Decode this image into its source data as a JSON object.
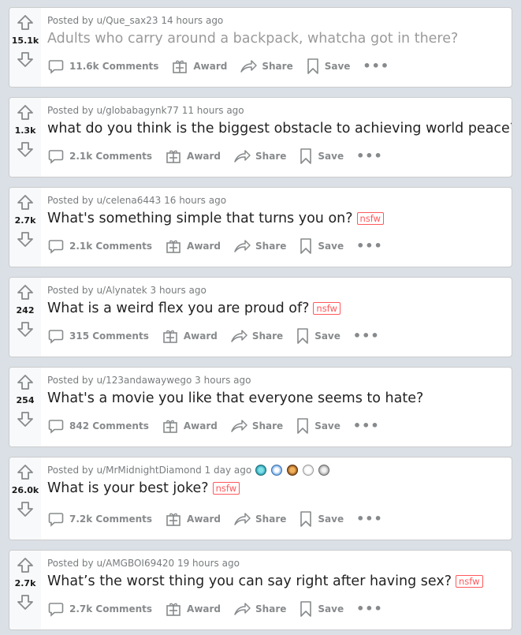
{
  "feed": {
    "posts": [
      {
        "author": "Posted by u/Que_sax23 14 hours ago",
        "score": "15.1k",
        "title": "Adults who carry around a backpack, whatcha got in there?",
        "comments": "11.6k Comments",
        "nsfw": false,
        "visited": true
      },
      {
        "author": "Posted by u/globabagynk77 11 hours ago",
        "score": "1.3k",
        "title": "what do you think is the biggest obstacle to achieving world peace?",
        "comments": "2.1k Comments",
        "nsfw": false,
        "visited": false
      },
      {
        "author": "Posted by u/celena6443 16 hours ago",
        "score": "2.7k",
        "title": "What's something simple that turns you on?",
        "comments": "2.1k Comments",
        "nsfw": true,
        "visited": false
      },
      {
        "author": "Posted by u/Alynatek 3 hours ago",
        "score": "242",
        "title": "What is a weird flex you are proud of?",
        "comments": "315 Comments",
        "nsfw": true,
        "visited": false
      },
      {
        "author": "Posted by u/123andawaywego 3 hours ago",
        "score": "254",
        "title": "What's a movie you like that everyone seems to hate?",
        "comments": "842 Comments",
        "nsfw": false,
        "visited": false
      },
      {
        "author": "Posted by u/MrMidnightDiamond 1 day ago",
        "score": "26.0k",
        "title": "What is your best joke?",
        "comments": "7.2k Comments",
        "nsfw": true,
        "visited": false,
        "awards": [
          "diamond-award-icon",
          "rocket-like-award-icon",
          "burger-award-icon",
          "wholesome-award-icon",
          "silver-award-icon"
        ]
      },
      {
        "author": "Posted by u/AMGBOI69420 19 hours ago",
        "score": "2.7k",
        "title": "What’s the worst thing you can say right after having sex?",
        "comments": "2.7k Comments",
        "nsfw": true,
        "visited": false
      }
    ],
    "labels": {
      "award": "Award",
      "share": "Share",
      "save": "Save",
      "nsfw": "nsfw",
      "more": "•••"
    }
  },
  "colors": {
    "background": "#dae0e6",
    "card": "#ffffff",
    "nsfw": "#ff585b",
    "muted": "#878a8c"
  }
}
